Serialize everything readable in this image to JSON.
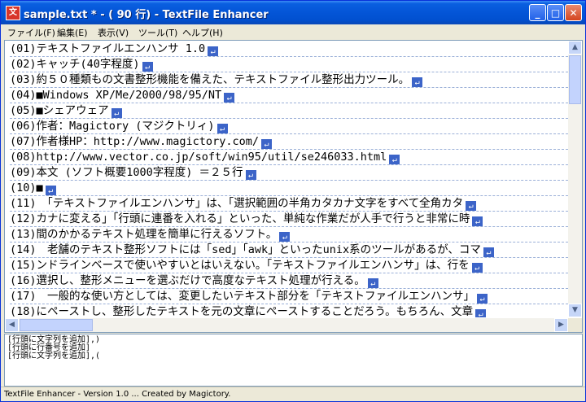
{
  "window": {
    "title": "sample.txt * - ( 90 行) - TextFile Enhancer",
    "buttons": {
      "minimize": "_",
      "maximize": "□",
      "close": "✕"
    }
  },
  "menu": [
    {
      "label": "ファイル(F)"
    },
    {
      "label": "編集(E)"
    },
    {
      "label": "表示(V)"
    },
    {
      "label": "ツール(T)"
    },
    {
      "label": "ヘルプ(H)"
    }
  ],
  "editor": {
    "line_end_glyph": "↵",
    "lines": [
      {
        "text": "(01)テキストファイルエンハンサ 1.0"
      },
      {
        "text": "(02)キャッチ(40字程度)"
      },
      {
        "text": "(03)約５０種類もの文書整形機能を備えた、テキストファイル整形出力ツール。"
      },
      {
        "text": "(04)■Windows XP/Me/2000/98/95/NT"
      },
      {
        "text": "(05)■シェアウェア"
      },
      {
        "text": "(06)作者：Magictory (マジクトリィ)"
      },
      {
        "text": "(07)作者様HP：http://www.magictory.com/"
      },
      {
        "text": "(08)http://www.vector.co.jp/soft/win95/util/se246033.html"
      },
      {
        "text": "(09)本文 (ソフト概要1000字程度) ＝２５行"
      },
      {
        "text": "(10)■"
      },
      {
        "text": "(11)　「テキストファイルエンハンサ」は、「選択範囲の半角カタカナ文字をすべて全角カタ"
      },
      {
        "text": "(12)カナに変える」「行頭に連番を入れる」といった、単純な作業だが人手で行うと非常に時"
      },
      {
        "text": "(13)間のかかるテキスト処理を簡単に行えるソフト。"
      },
      {
        "text": "(14)　老舗のテキスト整形ソフトには「sed」「awk」といったunix系のツールがあるが、コマ"
      },
      {
        "text": "(15)ンドラインベースで使いやすいとはいえない。「テキストファイルエンハンサ」は、行を"
      },
      {
        "text": "(16)選択し、整形メニューを選ぶだけで高度なテキスト処理が行える。"
      },
      {
        "text": "(17)　一般的な使い方としては、変更したいテキスト部分を「テキストファイルエンハンサ」"
      },
      {
        "text": "(18)にペーストし、整形したテキストを元の文章にペーストすることだろう。もちろん、文章"
      }
    ]
  },
  "log": [
    {
      "text": "[行頭に文字列を追加],)"
    },
    {
      "text": "[行頭に行番号を追加]"
    },
    {
      "text": "[行頭に文字列を追加],("
    }
  ],
  "status": "TextFile Enhancer - Version 1.0 ... Created by Magictory."
}
